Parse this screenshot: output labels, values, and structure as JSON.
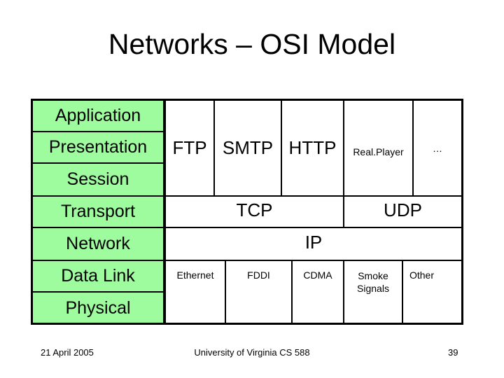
{
  "slide": {
    "title": "Networks – OSI Model",
    "footer": {
      "date": "21 April 2005",
      "center": "University of Virginia CS 588",
      "page": "39"
    }
  },
  "colors": {
    "layer_fill": "#9efb9e",
    "border": "#000000"
  },
  "osi_layers": [
    "Application",
    "Presentation",
    "Session",
    "Transport",
    "Network",
    "Data Link",
    "Physical"
  ],
  "application_protocols": [
    "FTP",
    "SMTP",
    "HTTP",
    "Real.Player",
    "…"
  ],
  "transport_protocols": [
    "TCP",
    "UDP"
  ],
  "network_protocols": [
    "IP"
  ],
  "link_protocols": [
    "Ethernet",
    "FDDI",
    "CDMA",
    "Smoke Signals",
    "Other"
  ]
}
